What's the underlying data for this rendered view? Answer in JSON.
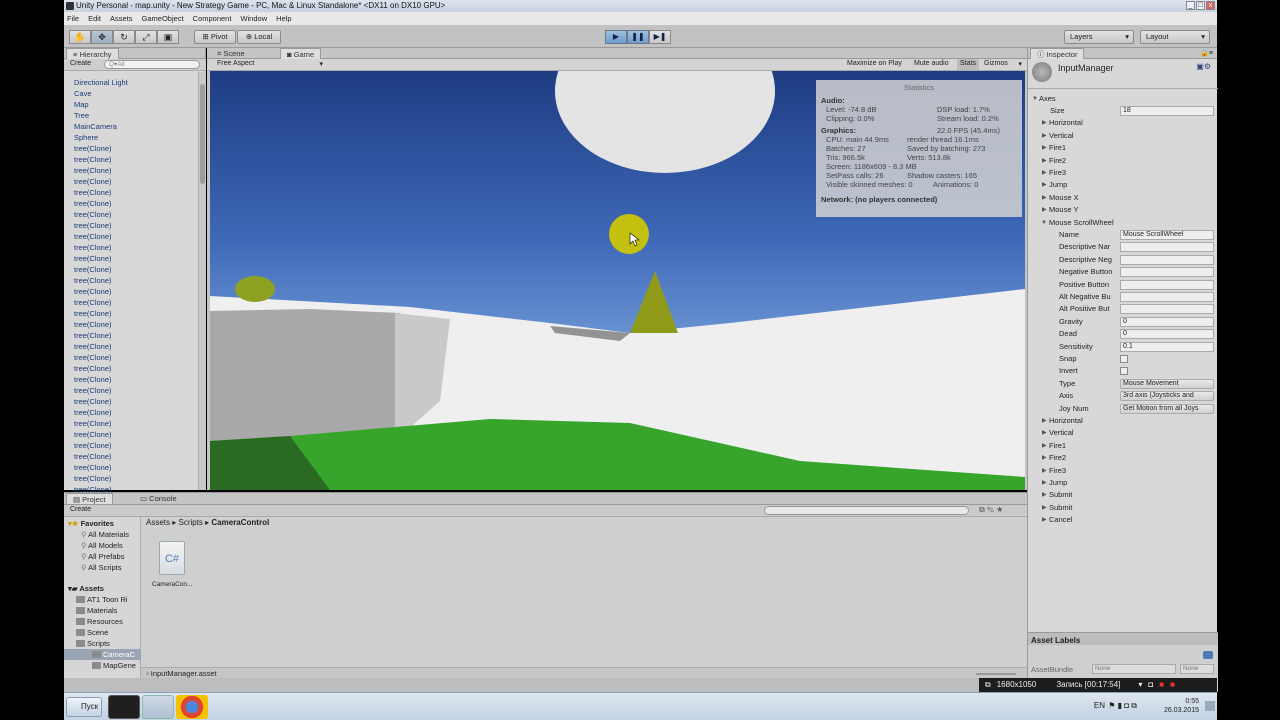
{
  "window": {
    "title": "Unity Personal - map.unity - New Strategy Game - PC, Mac & Linux Standalone* <DX11 on DX10 GPU>",
    "controls": [
      "_",
      "□",
      "x"
    ]
  },
  "menu": [
    "File",
    "Edit",
    "Assets",
    "GameObject",
    "Component",
    "Window",
    "Help"
  ],
  "toolbar": {
    "tools": [
      "hand-icon",
      "move-icon",
      "rotate-icon",
      "scale-icon",
      "rect-icon"
    ],
    "pivot": "Pivot",
    "local": "Local",
    "play": "▶",
    "pause": "❚❚",
    "step": "▶❚",
    "layers": "Layers",
    "layout": "Layout"
  },
  "hierarchy": {
    "tab": "Hierarchy",
    "create": "Create",
    "search_placeholder": "Q▾All",
    "items": [
      "Directional Light",
      "Cave",
      "Map",
      "Tree",
      "MainCamera",
      "Sphere",
      "tree(Clone)",
      "tree(Clone)",
      "tree(Clone)",
      "tree(Clone)",
      "tree(Clone)",
      "tree(Clone)",
      "tree(Clone)",
      "tree(Clone)",
      "tree(Clone)",
      "tree(Clone)",
      "tree(Clone)",
      "tree(Clone)",
      "tree(Clone)",
      "tree(Clone)",
      "tree(Clone)",
      "tree(Clone)",
      "tree(Clone)",
      "tree(Clone)",
      "tree(Clone)",
      "tree(Clone)",
      "tree(Clone)",
      "tree(Clone)",
      "tree(Clone)",
      "tree(Clone)",
      "tree(Clone)",
      "tree(Clone)",
      "tree(Clone)",
      "tree(Clone)",
      "tree(Clone)",
      "tree(Clone)",
      "tree(Clone)",
      "tree(Clone)"
    ]
  },
  "game": {
    "tabs": [
      "Scene",
      "Game"
    ],
    "aspect": "Free Aspect",
    "buttons": [
      "Maximize on Play",
      "Mute audio",
      "Stats",
      "Gizmos"
    ],
    "stats": {
      "title": "Statistics",
      "audio_label": "Audio:",
      "level": "Level: -74.8 dB",
      "dsp": "DSP load: 1.7%",
      "clipping": "Clipping: 0.0%",
      "stream": "Stream load: 0.2%",
      "graphics_label": "Graphics:",
      "fps": "22.0 FPS (45.4ms)",
      "cpu": "CPU: main 44.9ms",
      "render": "render thread 16.1ms",
      "batches": "Batches: 27",
      "saved": "Saved by batching: 273",
      "tris": "Tris: 966.5k",
      "verts": "Verts: 513.8k",
      "screen": "Screen: 1186x609 - 8.3 MB",
      "setpass": "SetPass calls: 26",
      "shadow": "Shadow casters: 165",
      "skinned": "Visible skinned meshes: 0",
      "anims": "Animations: 0",
      "network": "Network: (no players connected)"
    }
  },
  "inspector": {
    "tab": "Inspector",
    "name": "InputManager",
    "axes": "Axes",
    "size_label": "Size",
    "size_value": "18",
    "collapsed_top": [
      "Horizontal",
      "Vertical",
      "Fire1",
      "Fire2",
      "Fire3",
      "Jump",
      "Mouse X",
      "Mouse Y"
    ],
    "expanded_name": "Mouse ScrollWheel",
    "fields": [
      {
        "label": "Name",
        "value": "Mouse ScrollWheel",
        "kind": "text"
      },
      {
        "label": "Descriptive Nar",
        "value": "",
        "kind": "text"
      },
      {
        "label": "Descriptive Neg",
        "value": "",
        "kind": "text"
      },
      {
        "label": "Negative Button",
        "value": "",
        "kind": "text"
      },
      {
        "label": "Positive Button",
        "value": "",
        "kind": "text"
      },
      {
        "label": "Alt Negative Bu",
        "value": "",
        "kind": "text"
      },
      {
        "label": "Alt Positive But",
        "value": "",
        "kind": "text"
      },
      {
        "label": "Gravity",
        "value": "0",
        "kind": "text"
      },
      {
        "label": "Dead",
        "value": "0",
        "kind": "text"
      },
      {
        "label": "Sensitivity",
        "value": "0.1",
        "kind": "text"
      },
      {
        "label": "Snap",
        "value": "",
        "kind": "check"
      },
      {
        "label": "Invert",
        "value": "",
        "kind": "check"
      },
      {
        "label": "Type",
        "value": "Mouse Movement",
        "kind": "dropdown"
      },
      {
        "label": "Axis",
        "value": "3rd axis (Joysticks and",
        "kind": "dropdown"
      },
      {
        "label": "Joy Num",
        "value": "Get Motion from all Joys",
        "kind": "dropdown"
      }
    ],
    "collapsed_bottom": [
      "Horizontal",
      "Vertical",
      "Fire1",
      "Fire2",
      "Fire3",
      "Jump",
      "Submit",
      "Submit",
      "Cancel"
    ],
    "asset_labels": "Asset Labels",
    "asset_bundle": "AssetBundle",
    "bundle_value": "None",
    "bundle_variant": "None"
  },
  "project": {
    "tabs": [
      "Project",
      "Console"
    ],
    "create": "Create",
    "breadcrumb": [
      "Assets",
      "Scripts",
      "CameraControl"
    ],
    "favorites_label": "Favorites",
    "favorites": [
      "All Materials",
      "All Models",
      "All Prefabs",
      "All Scripts"
    ],
    "assets_label": "Assets",
    "folders": [
      "AT1 Toon Ri",
      "Materials",
      "Resources",
      "Scene",
      "Scripts"
    ],
    "subfolders": [
      "CameraC",
      "MapGene"
    ],
    "file_name": "CameraCon...",
    "file_glyph": "C#",
    "footer_file": "InputManager.asset"
  },
  "recorder": {
    "resolution": "1680x1050",
    "status": "Запись [00:17:54]"
  },
  "taskbar": {
    "start": "Пуск",
    "lang": "EN",
    "time": "0:55",
    "date": "26.03.2015"
  }
}
